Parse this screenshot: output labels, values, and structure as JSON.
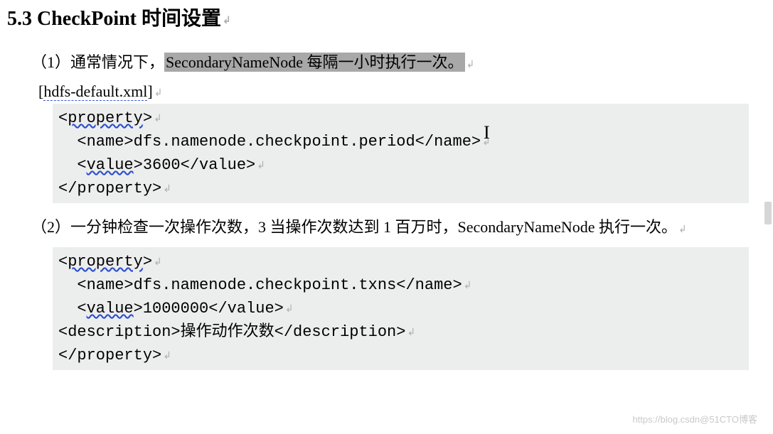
{
  "heading": "5.3 CheckPoint 时间设置",
  "para1_prefix": "（1）通常情况下，",
  "para1_highlight": "SecondaryNameNode 每隔一小时执行一次。",
  "file_label_open": "[",
  "file_label_name": "hdfs-default.xml",
  "file_label_close": "]",
  "code1": {
    "l1a": "<",
    "l1b": "property",
    "l1c": ">",
    "l2": "  <name>dfs.namenode.checkpoint.period</name>",
    "l3a": "  <",
    "l3b": "value",
    "l3c": ">3600</value>",
    "l4": "</property>"
  },
  "para2": "（2）一分钟检查一次操作次数，3 当操作次数达到 1 百万时，SecondaryNameNode 执行一次。",
  "code2": {
    "l1a": "<",
    "l1b": "property",
    "l1c": ">",
    "l2": "  <name>dfs.namenode.checkpoint.txns</name>",
    "l3a": "  <",
    "l3b": "value",
    "l3c": ">1000000</value>",
    "l4": "<description>操作动作次数</description>",
    "l5": "</property>"
  },
  "cursor_glyph": "I",
  "watermark": "https://blog.csdn@51CTO博客",
  "return_mark": "↲"
}
